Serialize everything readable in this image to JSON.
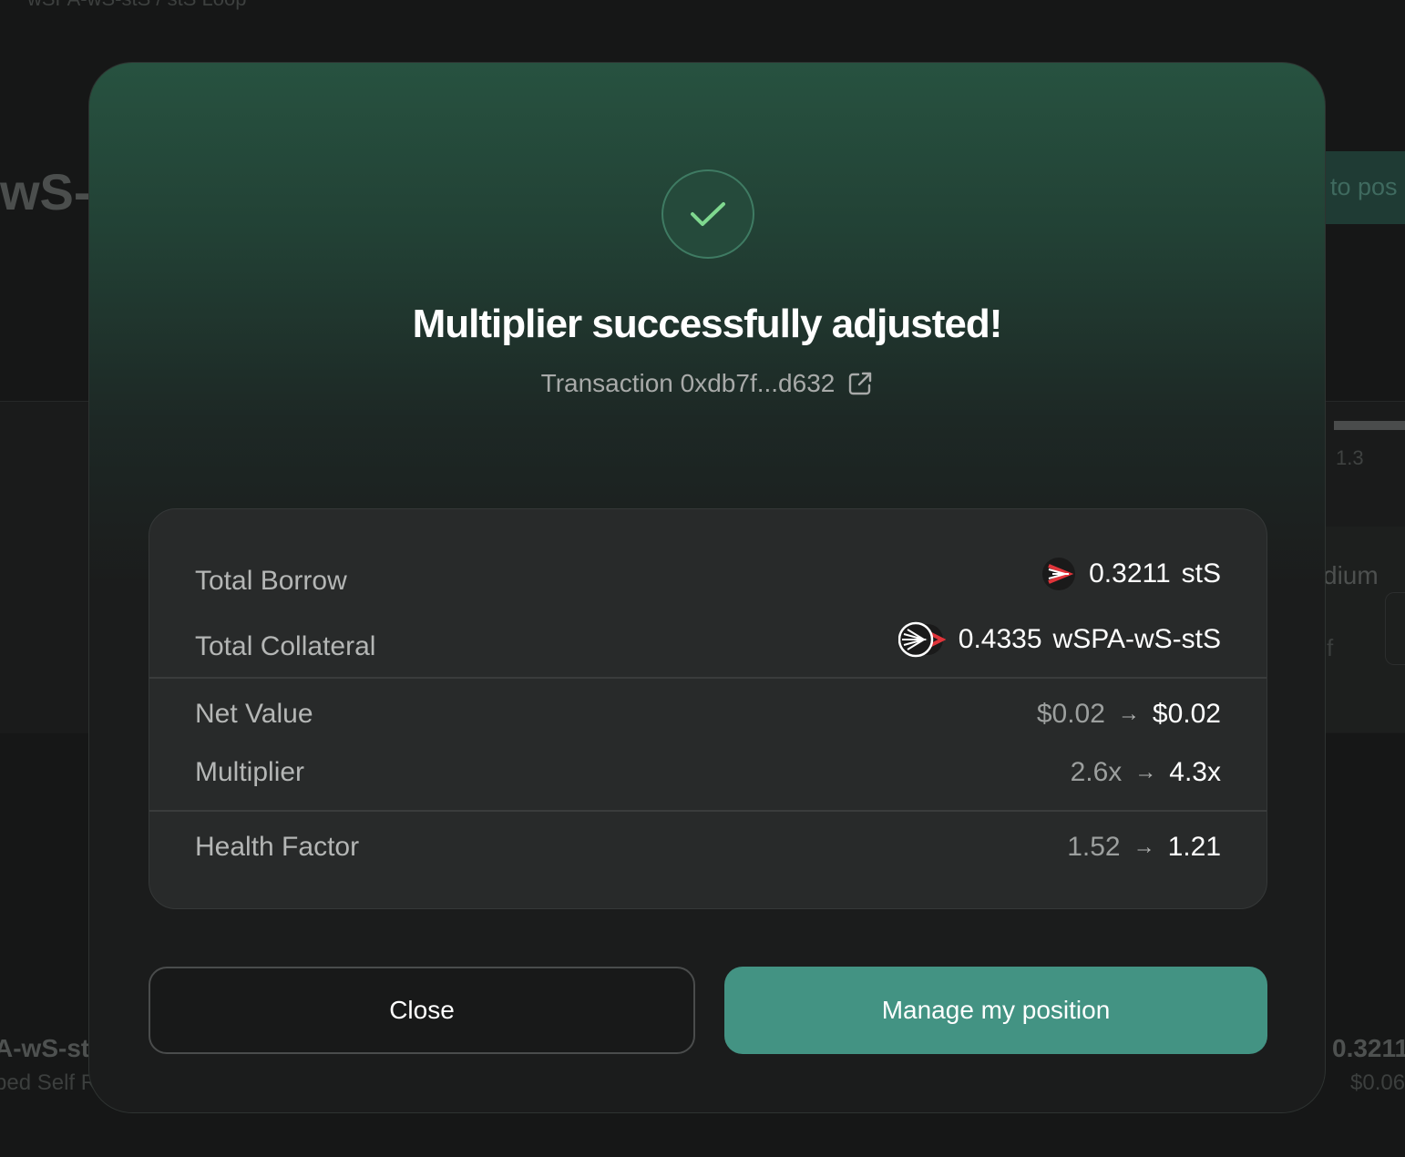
{
  "background": {
    "breadcrumb": "wSPA-wS-stS / stS Loop",
    "title": "wS-",
    "manage_button": "to pos",
    "tick": "1.3",
    "risk": "dium",
    "f": "f",
    "position_name": "A-wS-st",
    "position_sub": "ped Self R",
    "position_value": "0.3211",
    "position_usd": "$0.06"
  },
  "modal": {
    "title": "Multiplier successfully adjusted!",
    "tx_label": "Transaction 0xdb7f...d632",
    "success_icon": "check-icon",
    "summary": {
      "total_borrow": {
        "label": "Total Borrow",
        "amount": "0.3211",
        "token": "stS",
        "icon": "sts-token-icon"
      },
      "total_collateral": {
        "label": "Total Collateral",
        "amount": "0.4335",
        "token": "wSPA-wS-stS",
        "icon": "wspa-ws-sts-token-icon"
      },
      "net_value": {
        "label": "Net Value",
        "from": "$0.02",
        "to": "$0.02"
      },
      "multiplier": {
        "label": "Multiplier",
        "from": "2.6x",
        "to": "4.3x"
      },
      "health_factor": {
        "label": "Health Factor",
        "from": "1.52",
        "to": "1.21"
      },
      "arrow": "→"
    },
    "buttons": {
      "close": "Close",
      "manage": "Manage my position"
    },
    "colors": {
      "accent": "#439383",
      "success": "#7fd88f",
      "modal_top": "#275240"
    }
  }
}
